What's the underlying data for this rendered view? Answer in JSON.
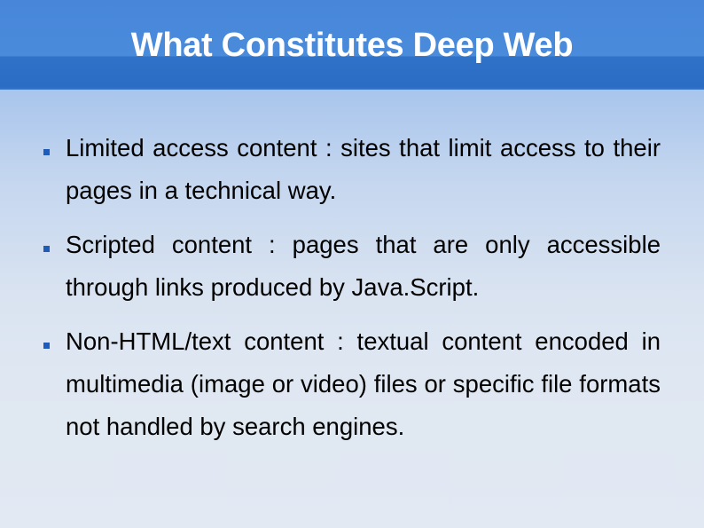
{
  "slide": {
    "title": "What Constitutes Deep Web",
    "bullets": [
      {
        "text": "Limited access content : sites that limit access to their pages in a technical way."
      },
      {
        "text": "Scripted content : pages that are only accessible through links produced by Java.Script."
      },
      {
        "text": "Non-HTML/text content : textual content encoded in multimedia (image or video) files or specific file formats not handled by search engines."
      }
    ]
  },
  "colors": {
    "header_blue": "#4a8bdb",
    "header_dark_blue": "#2b6cc4",
    "bullet_blue": "#1e5cbc",
    "title_text": "#ffffff",
    "body_text": "#000000"
  }
}
